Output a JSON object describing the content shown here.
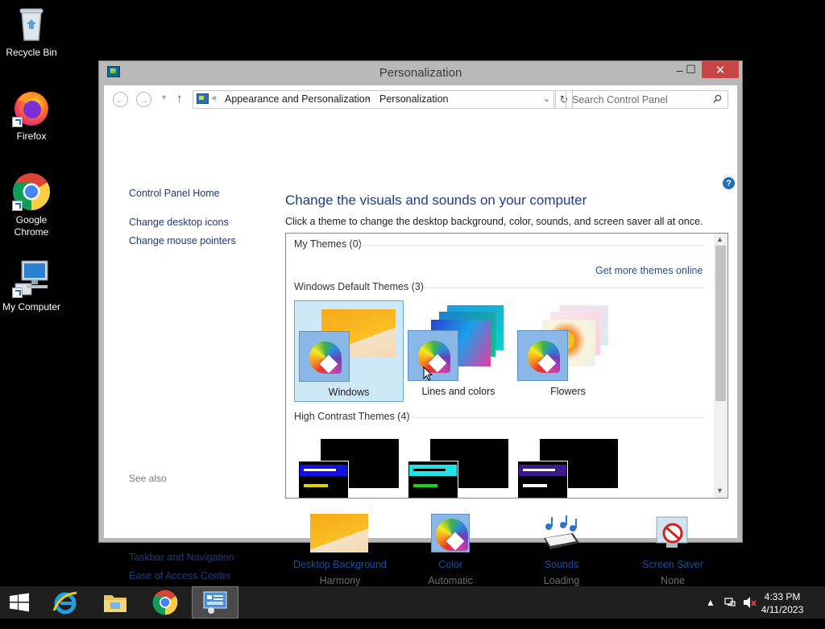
{
  "desktop": {
    "icons": [
      {
        "label": "Recycle Bin",
        "icon": "recycle-bin-icon"
      },
      {
        "label": "Firefox",
        "icon": "firefox-icon"
      },
      {
        "label": "Google Chrome",
        "icon": "chrome-icon"
      },
      {
        "label": "My Computer",
        "icon": "computer-icon"
      }
    ]
  },
  "window": {
    "title": "Personalization",
    "controls": {
      "minimize": "–",
      "maximize": "☐",
      "close": "✕"
    }
  },
  "address": {
    "chevrons": "«",
    "segments": [
      "Appearance and Personalization",
      "Personalization"
    ],
    "separator": "›",
    "dropdown": "⌄",
    "refresh": "↻"
  },
  "search": {
    "placeholder": "Search Control Panel"
  },
  "left_nav": {
    "home": "Control Panel Home",
    "links": [
      "Change desktop icons",
      "Change mouse pointers"
    ],
    "see_also_title": "See also",
    "see_also": [
      "Taskbar and Navigation",
      "Ease of Access Center"
    ]
  },
  "main": {
    "heading": "Change the visuals and sounds on your computer",
    "subtext": "Click a theme to change the desktop background, color, sounds, and screen saver all at once.",
    "groups": {
      "my_themes": "My Themes (0)",
      "get_more": "Get more themes online",
      "default": "Windows Default Themes (3)",
      "high_contrast": "High Contrast Themes (4)"
    },
    "themes": [
      {
        "label": "Windows",
        "selected": true
      },
      {
        "label": "Lines and colors",
        "selected": false
      },
      {
        "label": "Flowers",
        "selected": false
      }
    ],
    "high_contrast_themes": [
      {
        "highlight": "#1010e0",
        "accent": "#e0d000"
      },
      {
        "highlight": "#1fe3e8",
        "accent": "#1ad21a"
      },
      {
        "highlight": "#3a1a8a",
        "accent": "#ffffff"
      }
    ]
  },
  "bottom": [
    {
      "label": "Desktop Background",
      "value": "Harmony",
      "icon": "desktop-background-icon"
    },
    {
      "label": "Color",
      "value": "Automatic",
      "icon": "color-icon"
    },
    {
      "label": "Sounds",
      "value": "Loading",
      "icon": "sounds-icon"
    },
    {
      "label": "Screen Saver",
      "value": "None",
      "icon": "screen-saver-icon"
    }
  ],
  "taskbar": {
    "items": [
      "start-icon",
      "internet-explorer-icon",
      "file-explorer-icon",
      "chrome-icon",
      "control-panel-icon"
    ],
    "clock_time": "4:33 PM",
    "clock_date": "4/11/2023"
  },
  "colors": {
    "link": "#1f4f9e",
    "heading": "#1d3d8c",
    "selected_theme_bg": "#cde8f7",
    "close_button": "#c74545"
  }
}
